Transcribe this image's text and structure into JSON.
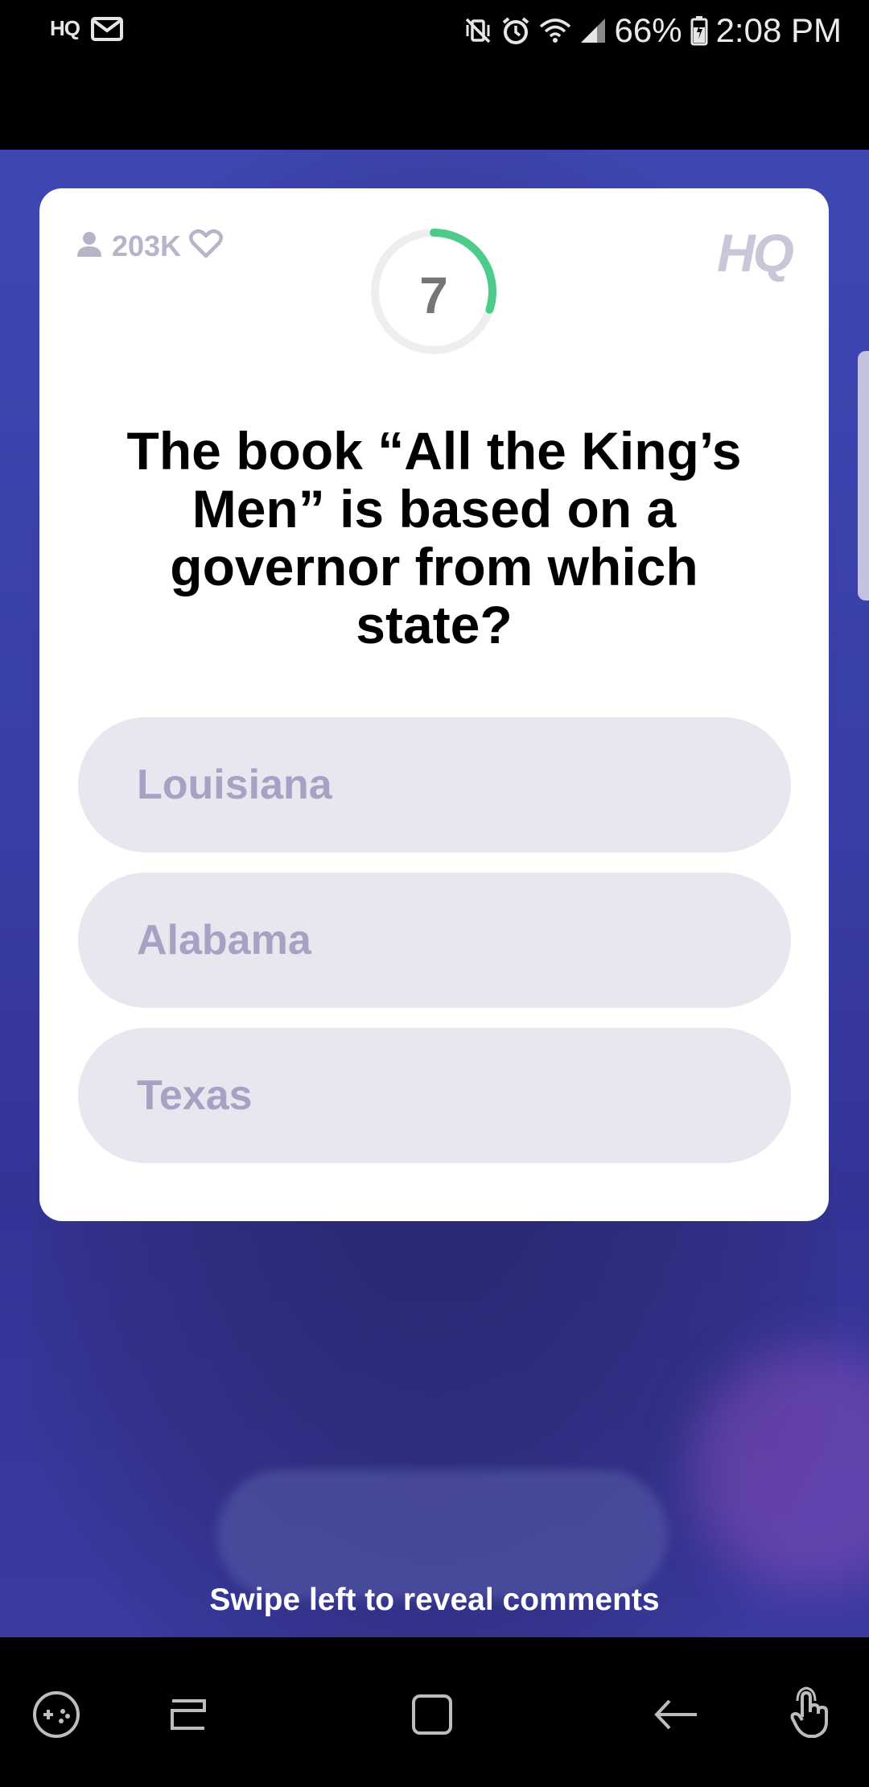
{
  "status_bar": {
    "app_badge": "HQ",
    "battery": "66%",
    "time": "2:08 PM"
  },
  "game": {
    "viewer_count": "203K",
    "logo_text": "HQ",
    "timer_value": "7",
    "timer_progress_fraction": 0.3,
    "question": "The book “All the King’s Men” is based on a governor from which state?",
    "answers": [
      {
        "label": "Louisiana"
      },
      {
        "label": "Alabama"
      },
      {
        "label": "Texas"
      }
    ],
    "swipe_hint": "Swipe left to reveal comments"
  },
  "colors": {
    "timer_accent": "#4ccb8a",
    "answer_bg": "#e8e7f0",
    "answer_text": "#a5a2c4",
    "video_bg": "#3c41ad"
  },
  "nav_bar": {
    "icons": [
      "game-tools-icon",
      "recents-icon",
      "home-icon",
      "back-icon",
      "touch-gesture-icon"
    ]
  }
}
